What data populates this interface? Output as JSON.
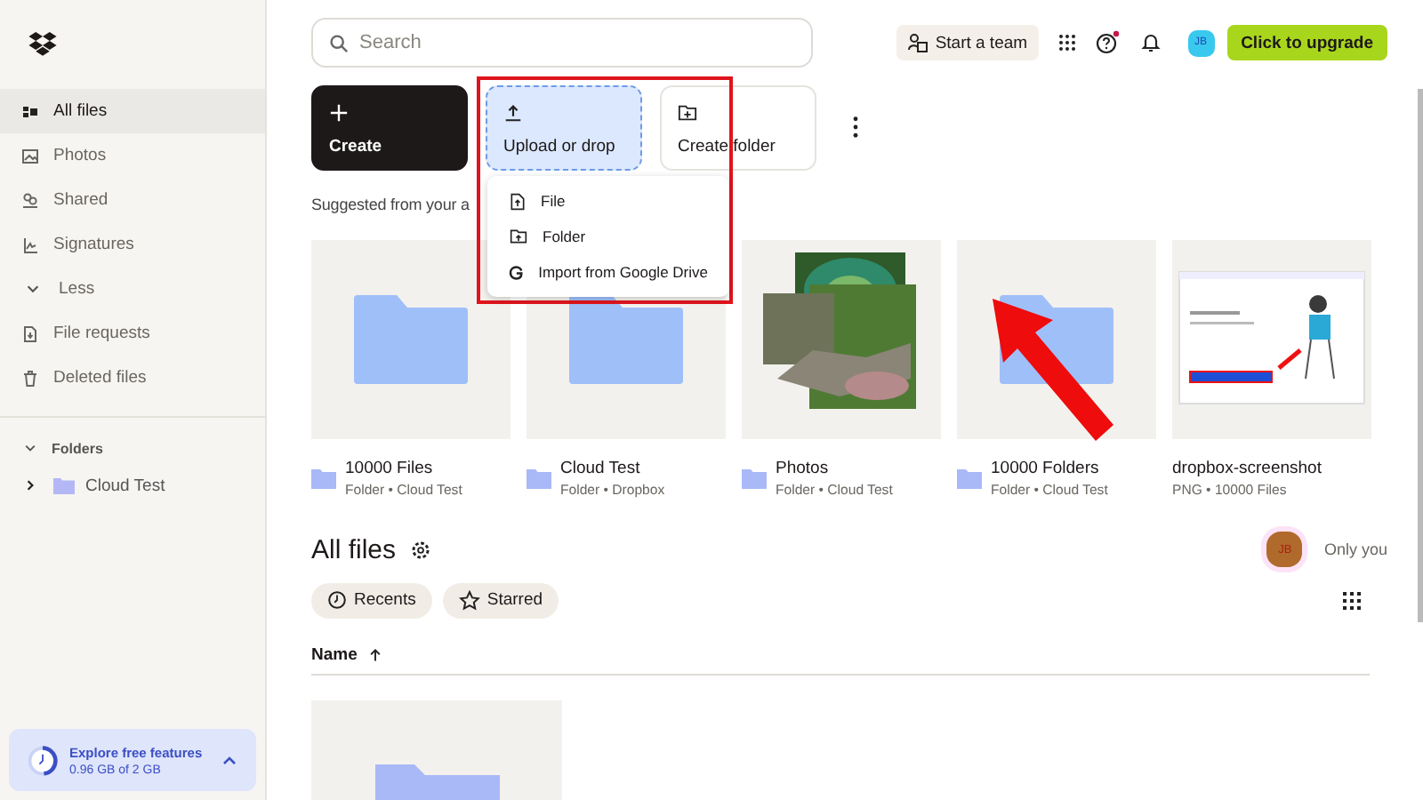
{
  "sidebar": {
    "items": [
      {
        "label": "All files",
        "kind": "link",
        "selected": true
      },
      {
        "label": "Photos",
        "kind": "link",
        "selected": false
      },
      {
        "label": "Shared",
        "kind": "link",
        "selected": false
      },
      {
        "label": "Signatures",
        "kind": "link",
        "selected": false
      },
      {
        "label": "Less",
        "kind": "toggle",
        "selected": false
      },
      {
        "label": "File requests",
        "kind": "link",
        "selected": false
      },
      {
        "label": "Deleted files",
        "kind": "link",
        "selected": false
      }
    ],
    "folders_heading": "Folders",
    "folders": [
      {
        "label": "Cloud Test",
        "expanded": false
      }
    ],
    "storage": {
      "title": "Explore free features",
      "usage": "0.96 GB of 2 GB",
      "level": 0.48
    }
  },
  "search": {
    "placeholder": "Search"
  },
  "topbar": {
    "team_button": "Start a team",
    "avatar": "JB",
    "upgrade_button": "Click to upgrade",
    "help_alert": true
  },
  "actions": [
    {
      "label": "Create",
      "kind": "create"
    },
    {
      "label": "Upload or drop",
      "kind": "upload"
    },
    {
      "label": "Create folder",
      "kind": "folder"
    }
  ],
  "upload_menu": [
    {
      "label": "File",
      "kind": "file"
    },
    {
      "label": "Folder",
      "kind": "folder"
    },
    {
      "label": "Import from Google Drive",
      "kind": "google"
    }
  ],
  "suggested_heading": "Suggested from your a",
  "suggested": [
    {
      "title": "10000 Files",
      "meta": "Folder • Cloud Test",
      "kind": "folder"
    },
    {
      "title": "Cloud Test",
      "meta": "Folder • Dropbox",
      "kind": "folder"
    },
    {
      "title": "Photos",
      "meta": "Folder • Cloud Test"
    },
    {
      "title": "10000 Folders",
      "meta": "Folder • Cloud Test",
      "kind": "folder"
    },
    {
      "title": "dropbox-screenshot",
      "meta": "PNG • 10000 Files",
      "kind": "screenshot"
    }
  ],
  "all_files": {
    "title": "All files",
    "owner_avatar": "JB",
    "owner_label": "Only you",
    "filters": [
      {
        "label": "Recents",
        "kind": "recent"
      },
      {
        "label": "Starred",
        "kind": "star"
      }
    ],
    "sort_column": "Name"
  }
}
